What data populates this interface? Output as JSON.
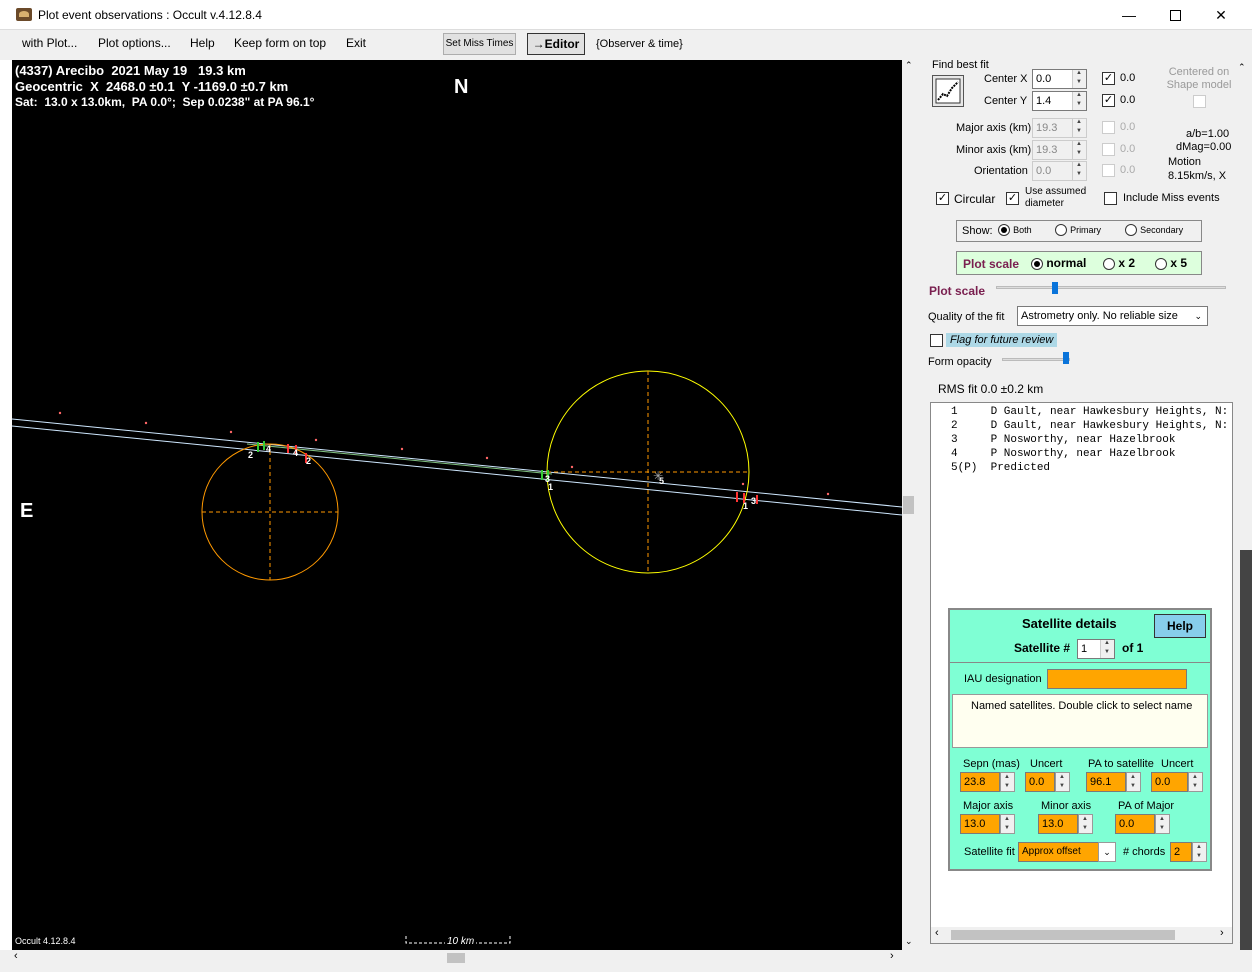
{
  "window": {
    "title": "Plot event observations : Occult v.4.12.8.4",
    "min_icon": "minimize-icon",
    "max_icon": "maximize-icon",
    "close_icon": "close-icon"
  },
  "menu": {
    "items": [
      "with Plot...",
      "Plot options...",
      "Help",
      "Keep form on top",
      "Exit"
    ],
    "set_miss_times": "Set Miss Times",
    "editor": "→Editor",
    "observer_time": "{Observer & time}"
  },
  "plot": {
    "header1": "(4337) Arecibo  2021 May 19   19.3 km",
    "header2": "Geocentric  X  2468.0 ±0.1  Y -1169.0 ±0.7 km",
    "header3": "Sat:  13.0 x 13.0km,  PA 0.0°;  Sep 0.0238\" at PA 96.1°",
    "north": "N",
    "east": "E",
    "footer": "Occult 4.12.8.4",
    "scale_label": "10 km",
    "chord_labels": [
      "2",
      "4",
      "4",
      "2",
      "3",
      "1",
      "5",
      "1",
      "3"
    ]
  },
  "panel": {
    "find_best_fit": "Find best fit",
    "center_x_label": "Center X",
    "center_x": "0.0",
    "center_x_fit": "0.0",
    "center_y_label": "Center Y",
    "center_y": "1.4",
    "center_y_fit": "0.0",
    "centered_on": "Centered on Shape model",
    "major_label": "Major axis (km)",
    "major": "19.3",
    "major_fit": "0.0",
    "minor_label": "Minor axis (km)",
    "minor": "19.3",
    "minor_fit": "0.0",
    "orient_label": "Orientation",
    "orient": "0.0",
    "orient_fit": "0.0",
    "ab": "a/b=1.00",
    "dmag": "dMag=0.00",
    "motion": "Motion",
    "motion_val": "8.15km/s, X",
    "circular": "Circular",
    "use_assumed": "Use assumed diameter",
    "include_miss": "Include Miss events",
    "show_label": "Show:",
    "show_both": "Both",
    "show_primary": "Primary",
    "show_secondary": "Secondary",
    "plot_scale": "Plot scale",
    "scale_normal": "normal",
    "scale_x2": "x 2",
    "scale_x5": "x 5",
    "plot_scale2": "Plot scale",
    "quality_label": "Quality of the fit",
    "quality_value": "Astrometry only. No reliable size",
    "flag_review": "Flag for future review",
    "form_opacity": "Form opacity",
    "rms": "RMS fit 0.0 ±0.2 km"
  },
  "observers": [
    "1     D Gault, near Hawkesbury Heights, N:",
    "2     D Gault, near Hawkesbury Heights, N:",
    "3     P Nosworthy, near Hazelbrook",
    "4     P Nosworthy, near Hazelbrook",
    "5(P)  Predicted"
  ],
  "satellite": {
    "title": "Satellite details",
    "help": "Help",
    "sat_num_label": "Satellite #",
    "sat_num": "1",
    "of": "of 1",
    "iau_label": "IAU designation",
    "named_sats": "Named satellites.   Double click to select name",
    "sepn_label": "Sepn (mas)",
    "sepn": "23.8",
    "uncert_label": "Uncert",
    "sepn_unc": "0.0",
    "pa_label": "PA to satellite",
    "pa": "96.1",
    "pa_uncert_label": "Uncert",
    "pa_unc": "0.0",
    "major_label": "Major axis",
    "major": "13.0",
    "minor_label": "Minor axis",
    "minor": "13.0",
    "pa_major_label": "PA of Major",
    "pa_major": "0.0",
    "fit_label": "Satellite fit",
    "fit_value": "Approx offset",
    "chords_label": "# chords",
    "chords": "2"
  },
  "colors": {
    "primary_ellipse": "#ffff00",
    "satellite_ellipse": "#ff9900",
    "chord_line": "#cfe8ff",
    "axis_dash": "#ff9900"
  }
}
